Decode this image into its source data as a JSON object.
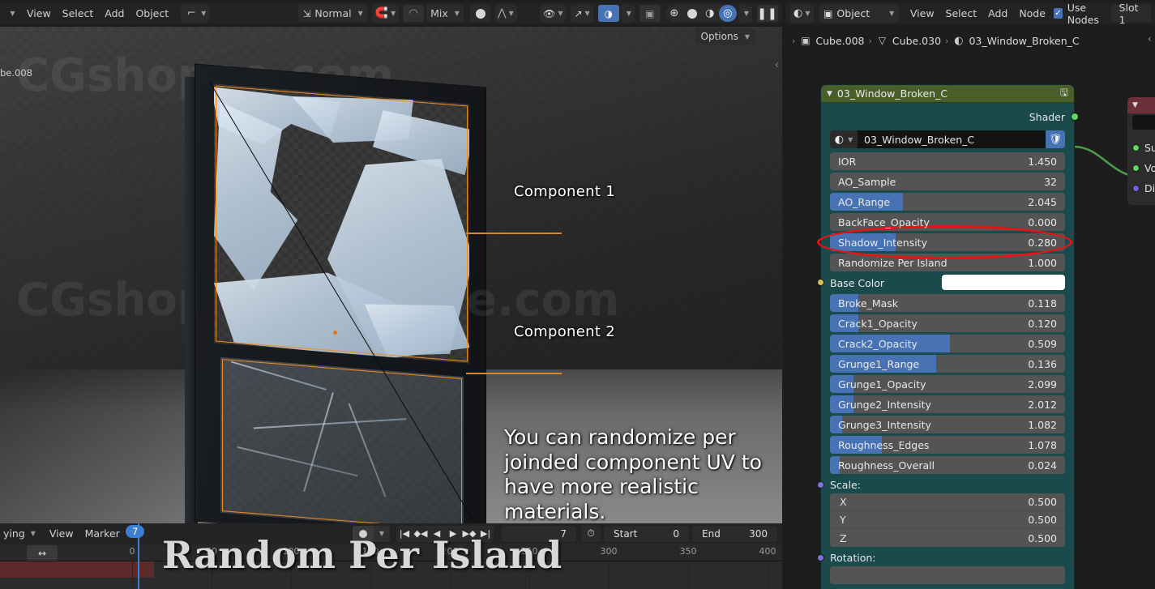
{
  "viewport_header": {
    "menus": [
      "View",
      "Select",
      "Add",
      "Object"
    ],
    "transform_orientation": "Normal",
    "proportional_mode": "Mix",
    "options_label": "Options"
  },
  "shader_header": {
    "editor_type_icon": "shading-ball-icon",
    "shader_type": "Object",
    "menus": [
      "View",
      "Select",
      "Add",
      "Node"
    ],
    "use_nodes_label": "Use Nodes",
    "use_nodes_checked": true,
    "slot_label": "Slot 1"
  },
  "breadcrumb": {
    "items": [
      {
        "icon": "object-icon",
        "label": "Cube.008"
      },
      {
        "icon": "mesh-data-icon",
        "label": "Cube.030"
      },
      {
        "icon": "material-icon",
        "label": "03_Window_Broken_C"
      }
    ]
  },
  "viewport": {
    "object_name_partial": "be.008",
    "watermarks": [
      "CGshopee.com",
      "CGshopee.com",
      "e.com"
    ],
    "annotations": [
      {
        "label": "Component 1"
      },
      {
        "label": "Component 2"
      }
    ],
    "tip_text": "You can randomize per joinded component UV to have more realistic materials."
  },
  "node": {
    "title": "03_Window_Broken_C",
    "output_socket_label": "Shader",
    "material_name": "03_Window_Broken_C",
    "properties": [
      {
        "name": "IOR",
        "value": "1.450",
        "fill": 0,
        "socket": "#9a9a9a"
      },
      {
        "name": "AO_Sample",
        "value": "32",
        "fill": 0,
        "socket": "#7ec46f"
      },
      {
        "name": "AO_Range",
        "value": "2.045",
        "fill": 31,
        "socket": "#9a9a9a"
      },
      {
        "name": "BackFace_Opacity",
        "value": "0.000",
        "fill": 0,
        "socket": "#9a9a9a"
      },
      {
        "name": "Shadow_Intensity",
        "value": "0.280",
        "fill": 28,
        "socket": "#9a9a9a"
      },
      {
        "name": "Randomize Per Island",
        "value": "1.000",
        "fill": 0,
        "socket": "#b08a8a"
      },
      {
        "name": "Broke_Mask",
        "value": "0.118",
        "fill": 12,
        "socket": "#9a9a9a"
      },
      {
        "name": "Crack1_Opacity",
        "value": "0.120",
        "fill": 12,
        "socket": "#9a9a9a"
      },
      {
        "name": "Crack2_Opacity",
        "value": "0.509",
        "fill": 51,
        "socket": "#9a9a9a"
      },
      {
        "name": "Grunge1_Range",
        "value": "0.136",
        "fill": 45,
        "socket": "#9a9a9a"
      },
      {
        "name": "Grunge1_Opacity",
        "value": "2.099",
        "fill": 10,
        "socket": "#9a9a9a"
      },
      {
        "name": "Grunge2_Intensity",
        "value": "2.012",
        "fill": 10,
        "socket": "#9a9a9a"
      },
      {
        "name": "Grunge3_Intensity",
        "value": "1.082",
        "fill": 5,
        "socket": "#9a9a9a"
      },
      {
        "name": "Roughness_Edges",
        "value": "1.078",
        "fill": 22,
        "socket": "#9a9a9a"
      },
      {
        "name": "Roughness_Overall",
        "value": "0.024",
        "fill": 4,
        "socket": "#9a9a9a"
      }
    ],
    "base_color": {
      "name": "Base Color",
      "swatch": "#ffffff",
      "socket": "#d9c04a"
    },
    "scale": {
      "label": "Scale:",
      "socket": "#7a73e0",
      "axes": [
        {
          "name": "X",
          "value": "0.500"
        },
        {
          "name": "Y",
          "value": "0.500"
        },
        {
          "name": "Z",
          "value": "0.500"
        }
      ]
    },
    "rotation": {
      "label": "Rotation:",
      "socket": "#7a73e0"
    }
  },
  "output_node": {
    "sockets": [
      "Su",
      "Vo",
      "Di"
    ]
  },
  "timeline": {
    "editor_mode_partial": "ying",
    "menus": [
      "View",
      "Marker"
    ],
    "current_frame": "7",
    "start_label": "Start",
    "start_value": "0",
    "end_label": "End",
    "end_value": "300",
    "ticks": [
      "0",
      "50",
      "100",
      "150",
      "200",
      "250",
      "300",
      "350",
      "400"
    ],
    "playhead_frame": "7"
  },
  "overlay_title": "Random Per Island",
  "colors": {
    "accent_blue": "#4772b3",
    "node_header_green": "#4a5e2a",
    "node_body_teal": "#1b4a4d",
    "selection_orange": "#f08b1d",
    "highlight_red": "#ee1111"
  }
}
